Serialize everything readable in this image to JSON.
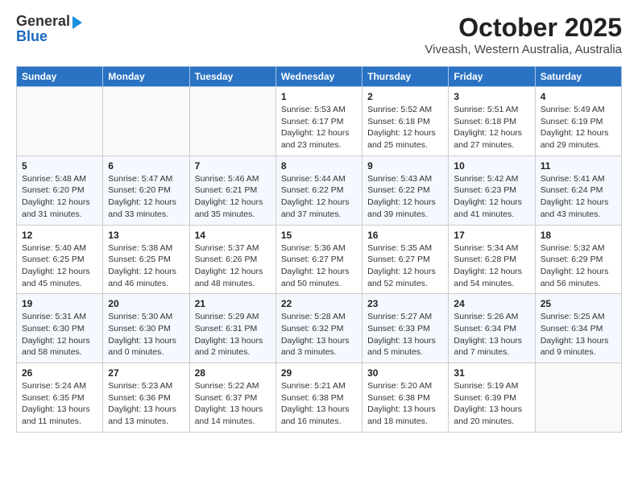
{
  "header": {
    "logo_line1": "General",
    "logo_line2": "Blue",
    "title": "October 2025",
    "subtitle": "Viveash, Western Australia, Australia"
  },
  "weekdays": [
    "Sunday",
    "Monday",
    "Tuesday",
    "Wednesday",
    "Thursday",
    "Friday",
    "Saturday"
  ],
  "weeks": [
    [
      {
        "day": "",
        "info": ""
      },
      {
        "day": "",
        "info": ""
      },
      {
        "day": "",
        "info": ""
      },
      {
        "day": "1",
        "info": "Sunrise: 5:53 AM\nSunset: 6:17 PM\nDaylight: 12 hours\nand 23 minutes."
      },
      {
        "day": "2",
        "info": "Sunrise: 5:52 AM\nSunset: 6:18 PM\nDaylight: 12 hours\nand 25 minutes."
      },
      {
        "day": "3",
        "info": "Sunrise: 5:51 AM\nSunset: 6:18 PM\nDaylight: 12 hours\nand 27 minutes."
      },
      {
        "day": "4",
        "info": "Sunrise: 5:49 AM\nSunset: 6:19 PM\nDaylight: 12 hours\nand 29 minutes."
      }
    ],
    [
      {
        "day": "5",
        "info": "Sunrise: 5:48 AM\nSunset: 6:20 PM\nDaylight: 12 hours\nand 31 minutes."
      },
      {
        "day": "6",
        "info": "Sunrise: 5:47 AM\nSunset: 6:20 PM\nDaylight: 12 hours\nand 33 minutes."
      },
      {
        "day": "7",
        "info": "Sunrise: 5:46 AM\nSunset: 6:21 PM\nDaylight: 12 hours\nand 35 minutes."
      },
      {
        "day": "8",
        "info": "Sunrise: 5:44 AM\nSunset: 6:22 PM\nDaylight: 12 hours\nand 37 minutes."
      },
      {
        "day": "9",
        "info": "Sunrise: 5:43 AM\nSunset: 6:22 PM\nDaylight: 12 hours\nand 39 minutes."
      },
      {
        "day": "10",
        "info": "Sunrise: 5:42 AM\nSunset: 6:23 PM\nDaylight: 12 hours\nand 41 minutes."
      },
      {
        "day": "11",
        "info": "Sunrise: 5:41 AM\nSunset: 6:24 PM\nDaylight: 12 hours\nand 43 minutes."
      }
    ],
    [
      {
        "day": "12",
        "info": "Sunrise: 5:40 AM\nSunset: 6:25 PM\nDaylight: 12 hours\nand 45 minutes."
      },
      {
        "day": "13",
        "info": "Sunrise: 5:38 AM\nSunset: 6:25 PM\nDaylight: 12 hours\nand 46 minutes."
      },
      {
        "day": "14",
        "info": "Sunrise: 5:37 AM\nSunset: 6:26 PM\nDaylight: 12 hours\nand 48 minutes."
      },
      {
        "day": "15",
        "info": "Sunrise: 5:36 AM\nSunset: 6:27 PM\nDaylight: 12 hours\nand 50 minutes."
      },
      {
        "day": "16",
        "info": "Sunrise: 5:35 AM\nSunset: 6:27 PM\nDaylight: 12 hours\nand 52 minutes."
      },
      {
        "day": "17",
        "info": "Sunrise: 5:34 AM\nSunset: 6:28 PM\nDaylight: 12 hours\nand 54 minutes."
      },
      {
        "day": "18",
        "info": "Sunrise: 5:32 AM\nSunset: 6:29 PM\nDaylight: 12 hours\nand 56 minutes."
      }
    ],
    [
      {
        "day": "19",
        "info": "Sunrise: 5:31 AM\nSunset: 6:30 PM\nDaylight: 12 hours\nand 58 minutes."
      },
      {
        "day": "20",
        "info": "Sunrise: 5:30 AM\nSunset: 6:30 PM\nDaylight: 13 hours\nand 0 minutes."
      },
      {
        "day": "21",
        "info": "Sunrise: 5:29 AM\nSunset: 6:31 PM\nDaylight: 13 hours\nand 2 minutes."
      },
      {
        "day": "22",
        "info": "Sunrise: 5:28 AM\nSunset: 6:32 PM\nDaylight: 13 hours\nand 3 minutes."
      },
      {
        "day": "23",
        "info": "Sunrise: 5:27 AM\nSunset: 6:33 PM\nDaylight: 13 hours\nand 5 minutes."
      },
      {
        "day": "24",
        "info": "Sunrise: 5:26 AM\nSunset: 6:34 PM\nDaylight: 13 hours\nand 7 minutes."
      },
      {
        "day": "25",
        "info": "Sunrise: 5:25 AM\nSunset: 6:34 PM\nDaylight: 13 hours\nand 9 minutes."
      }
    ],
    [
      {
        "day": "26",
        "info": "Sunrise: 5:24 AM\nSunset: 6:35 PM\nDaylight: 13 hours\nand 11 minutes."
      },
      {
        "day": "27",
        "info": "Sunrise: 5:23 AM\nSunset: 6:36 PM\nDaylight: 13 hours\nand 13 minutes."
      },
      {
        "day": "28",
        "info": "Sunrise: 5:22 AM\nSunset: 6:37 PM\nDaylight: 13 hours\nand 14 minutes."
      },
      {
        "day": "29",
        "info": "Sunrise: 5:21 AM\nSunset: 6:38 PM\nDaylight: 13 hours\nand 16 minutes."
      },
      {
        "day": "30",
        "info": "Sunrise: 5:20 AM\nSunset: 6:38 PM\nDaylight: 13 hours\nand 18 minutes."
      },
      {
        "day": "31",
        "info": "Sunrise: 5:19 AM\nSunset: 6:39 PM\nDaylight: 13 hours\nand 20 minutes."
      },
      {
        "day": "",
        "info": ""
      }
    ]
  ]
}
